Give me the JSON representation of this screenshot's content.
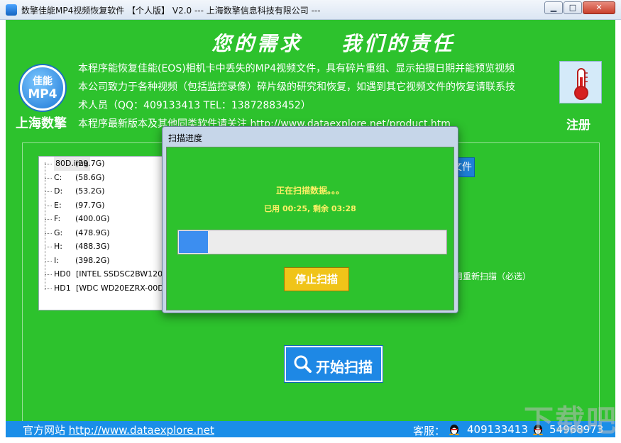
{
  "window": {
    "title": "数擎佳能MP4视频恢复软件  【个人版】  V2.0  --- 上海数擎信息科技有限公司 ---",
    "min_glyph": "▁",
    "max_glyph": "□",
    "close_glyph": "✕"
  },
  "header": {
    "slogan": "您的需求    我们的责任",
    "logo_line1": "佳能",
    "logo_line2": "MP4",
    "logo_name": "上海数擎",
    "info_lines": [
      "本程序能恢复佳能(EOS)相机卡中丢失的MP4视频文件，具有碎片重组、显示拍摄日期并能预览视频",
      "本公司致力于各种视频（包括监控录像）碎片级的研究和恢复，如遇到其它视频文件的恢复请联系技",
      "术人员（QQ：409133413  TEL：13872883452）",
      "本程序最新版本及其他同类软件请关注 http://www.dataexplore.net/product.htm"
    ],
    "register_label": "注册"
  },
  "drives": [
    {
      "name": "80D.img",
      "size": "(29.7G)",
      "selected": true
    },
    {
      "name": "C:",
      "size": "(58.6G)"
    },
    {
      "name": "D:",
      "size": "(53.2G)"
    },
    {
      "name": "E:",
      "size": "(97.7G)"
    },
    {
      "name": "F:",
      "size": "(400.0G)"
    },
    {
      "name": "G:",
      "size": "(478.9G)"
    },
    {
      "name": "H:",
      "size": "(488.3G)"
    },
    {
      "name": "I:",
      "size": "(398.2G)"
    },
    {
      "name": "HD0",
      "size": "[INTEL SSDSC2BW120A4"
    },
    {
      "name": "HD1",
      "size": "[WDC WD20EZRX-00D8P"
    }
  ],
  "main": {
    "hidden_button_text": "文件",
    "rescan_text": "用重新扫描（必选）",
    "start_scan_label": "开始扫描"
  },
  "footer": {
    "site_label": "官方网站",
    "site_url": "http://www.dataexplore.net",
    "service_label": "客服：",
    "qq1": "409133413",
    "qq2": "54968973"
  },
  "dialog": {
    "title": "扫描进度",
    "status": "正在扫描数据。。。",
    "time": "已用 00:25, 剩余 03:28",
    "progress_fraction": 0.11,
    "stop_label": "停止扫描"
  },
  "watermark": "下载吧",
  "colors": {
    "panel_green": "#2dc22d",
    "accent_blue": "#1e88e5",
    "stop_yellow": "#f0c419",
    "progress_blue": "#3c8ef0"
  },
  "icons": {
    "logo": "canon-mp4-badge-icon",
    "register": "thermometer-icon",
    "start": "magnifier-icon",
    "qq": "qq-penguin-icon"
  }
}
